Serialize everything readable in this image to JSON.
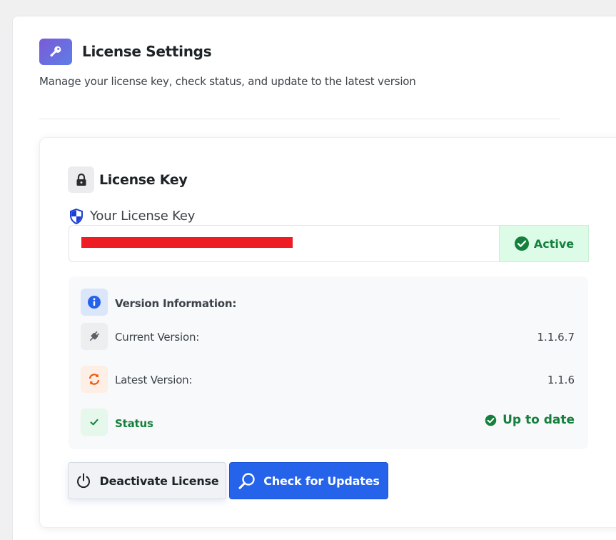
{
  "header": {
    "title": "License Settings",
    "description": "Manage your license key, check status, and update to the latest version",
    "icon": "key-icon"
  },
  "license_section": {
    "title": "License Key",
    "icon": "lock-icon",
    "field_label": "Your License Key",
    "field_icon": "shield-icon",
    "status_badge": "Active",
    "status_color": "#15803d"
  },
  "version_info": {
    "heading": "Version Information:",
    "current_label": "Current Version:",
    "current_value": "1.1.6.7",
    "latest_label": "Latest Version:",
    "latest_value": "1.1.6",
    "status_label": "Status",
    "status_value": "Up to date"
  },
  "actions": {
    "deactivate_label": "Deactivate License",
    "check_label": "Check for Updates"
  },
  "colors": {
    "accent": "#2563eb",
    "success": "#15803d",
    "redaction": "#ee1d23"
  }
}
